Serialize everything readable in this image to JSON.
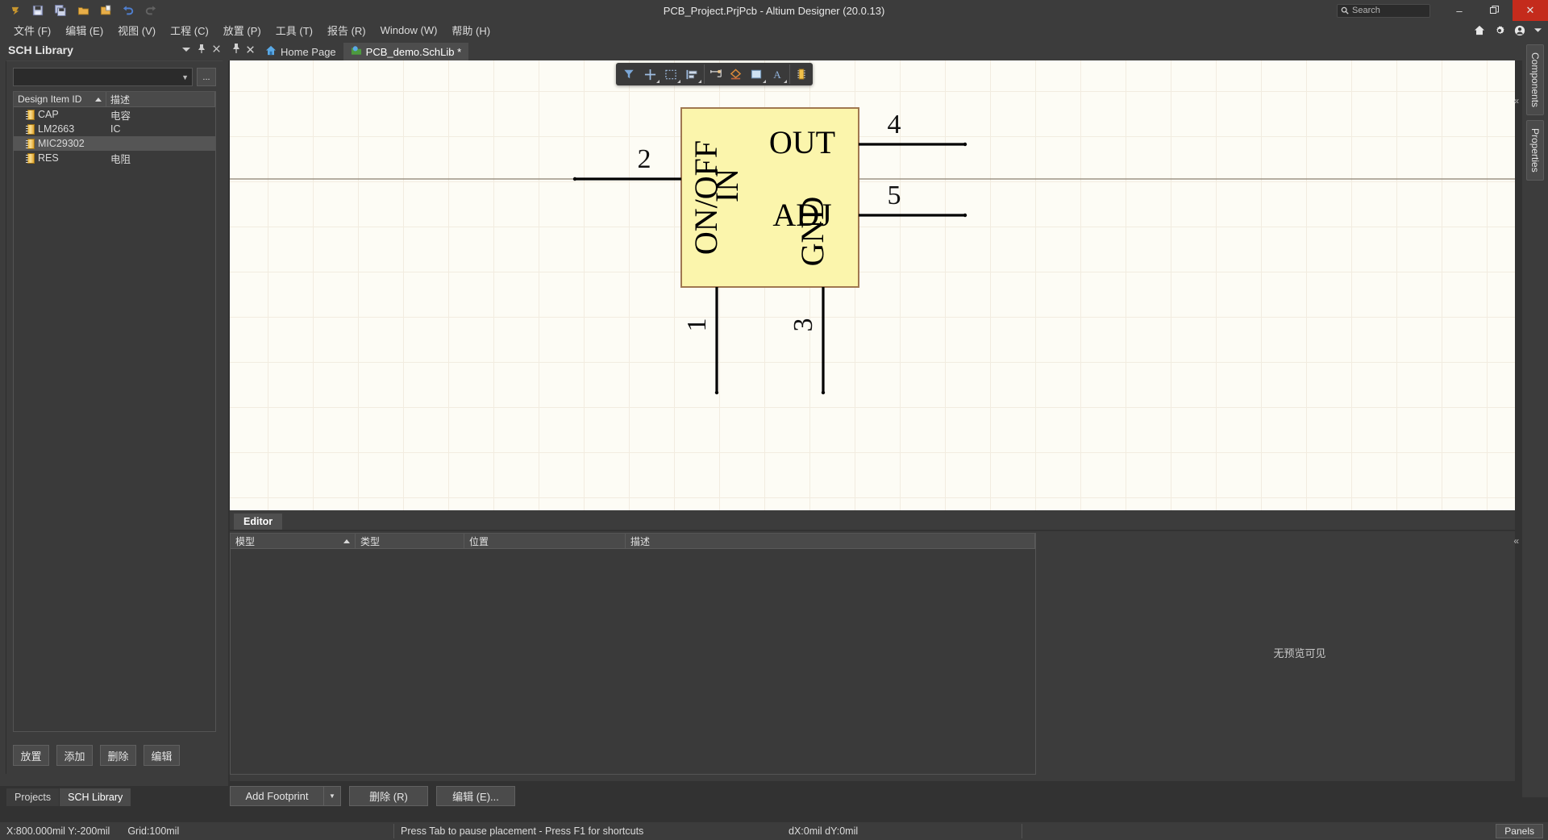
{
  "titlebar": {
    "title": "PCB_Project.PrjPcb - Altium Designer (20.0.13)",
    "search_placeholder": "Search",
    "minimize": "–",
    "restore": "❐",
    "close": "✕",
    "icons": [
      "altium-logo-icon",
      "save-icon",
      "save-all-icon",
      "open-icon",
      "open-project-icon",
      "undo-icon",
      "redo-icon"
    ]
  },
  "menubar": {
    "items": [
      {
        "label": "文件 (F)"
      },
      {
        "label": "编辑 (E)"
      },
      {
        "label": "视图 (V)"
      },
      {
        "label": "工程 (C)"
      },
      {
        "label": "放置 (P)"
      },
      {
        "label": "工具 (T)"
      },
      {
        "label": "报告 (R)"
      },
      {
        "label": "Window (W)"
      },
      {
        "label": "帮助 (H)"
      }
    ],
    "right_icons": [
      "home-icon",
      "gear-icon",
      "account-icon",
      "chevron-down-icon"
    ]
  },
  "sidebar": {
    "title": "SCH Library",
    "header_buttons": [
      "chevron-down-icon",
      "pin-icon",
      "close-icon"
    ],
    "library_select_value": "",
    "dots_button": "...",
    "columns": [
      "Design Item ID",
      "描述"
    ],
    "rows": [
      {
        "id": "CAP",
        "desc": "电容",
        "selected": false
      },
      {
        "id": "LM2663",
        "desc": "IC",
        "selected": false
      },
      {
        "id": "MIC29302",
        "desc": "",
        "selected": true
      },
      {
        "id": "RES",
        "desc": "电阻",
        "selected": false
      }
    ],
    "buttons": [
      "放置",
      "添加",
      "删除",
      "编辑"
    ],
    "tabs": [
      {
        "label": "Projects",
        "active": false
      },
      {
        "label": "SCH Library",
        "active": true
      }
    ]
  },
  "document_tabs": [
    {
      "label": "Home Page",
      "icon": "home-icon",
      "active": false
    },
    {
      "label": "PCB_demo.SchLib *",
      "icon": "schlib-icon",
      "active": true
    }
  ],
  "canvas_toolbar": {
    "buttons": [
      {
        "name": "filter-icon"
      },
      {
        "name": "crosshair-icon"
      },
      {
        "name": "selection-rectangle-icon"
      },
      {
        "name": "align-icon"
      },
      {
        "name": "place-pin-icon"
      },
      {
        "name": "place-symbol-icon"
      },
      {
        "name": "place-rectangle-icon"
      },
      {
        "name": "place-text-icon"
      },
      {
        "name": "place-component-icon"
      }
    ]
  },
  "schematic": {
    "body_fill": "#fbf5ac",
    "body_stroke": "#a07850",
    "pins": [
      {
        "number": "1",
        "name": "ON/OFF",
        "side": "bottom"
      },
      {
        "number": "2",
        "name": "IN",
        "side": "left"
      },
      {
        "number": "3",
        "name": "GND",
        "side": "bottom"
      },
      {
        "number": "4",
        "name": "OUT",
        "side": "right"
      },
      {
        "number": "5",
        "name": "ADJ",
        "side": "right"
      }
    ]
  },
  "editor_strip": {
    "tab": "Editor"
  },
  "model_table": {
    "columns": [
      "模型",
      "类型",
      "位置",
      "描述"
    ],
    "rows": [],
    "preview_message": "无预览可见"
  },
  "footer_buttons": {
    "add_footprint": "Add Footprint",
    "delete": "删除 (R)",
    "edit": "编辑 (E)..."
  },
  "right_panel_tabs": [
    {
      "label": "Components"
    },
    {
      "label": "Properties"
    }
  ],
  "statusbar": {
    "coordinates": "X:800.000mil Y:-200mil",
    "grid": "Grid:100mil",
    "message": "Press Tab to pause placement - Press F1 for shortcuts",
    "delta": "dX:0mil dY:0mil",
    "panels": "Panels"
  },
  "colors": {
    "accent_red": "#c42b1c",
    "chrome": "#3c3c3c",
    "canvas": "#fdfcf5",
    "symbol_fill": "#fbf5ac"
  }
}
